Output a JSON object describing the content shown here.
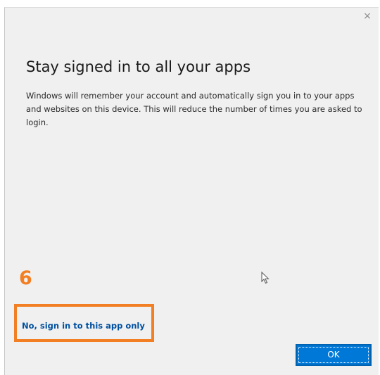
{
  "dialog": {
    "close_glyph": "×",
    "title": "Stay signed in to all your apps",
    "description": "Windows will remember your account and automatically sign you in to your apps and websites on this device. This will reduce the number of times you are asked to login.",
    "secondary_link": "No, sign in to this app only",
    "ok_label": "OK"
  },
  "annotation": {
    "step_number": "6",
    "color": "#f27f23"
  },
  "icons": {
    "cursor": "mouse-pointer-icon",
    "close": "close-icon"
  },
  "colors": {
    "accent": "#0078d7",
    "link": "#0050a0",
    "dialog_bg": "#f0f0f0"
  }
}
